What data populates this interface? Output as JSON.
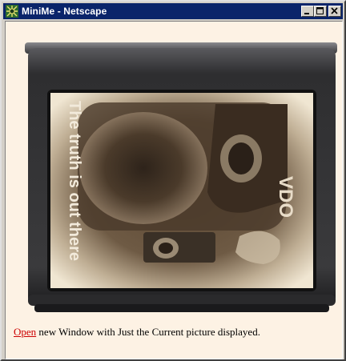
{
  "window": {
    "title": "MiniMe - Netscape",
    "icon": "netscape-app-icon",
    "controls": [
      "minimize-icon",
      "maximize-icon",
      "close-icon"
    ]
  },
  "picture": {
    "overlay_text": "The truth is out there",
    "device_label": "VDO"
  },
  "caption": {
    "link_text": "Open",
    "rest_text": " new Window with Just the Current picture displayed."
  },
  "colors": {
    "titlebar": "#0a246a",
    "page_background": "#fdf2e4",
    "link": "#cc0000",
    "tv_body": "#3a3a3c"
  }
}
